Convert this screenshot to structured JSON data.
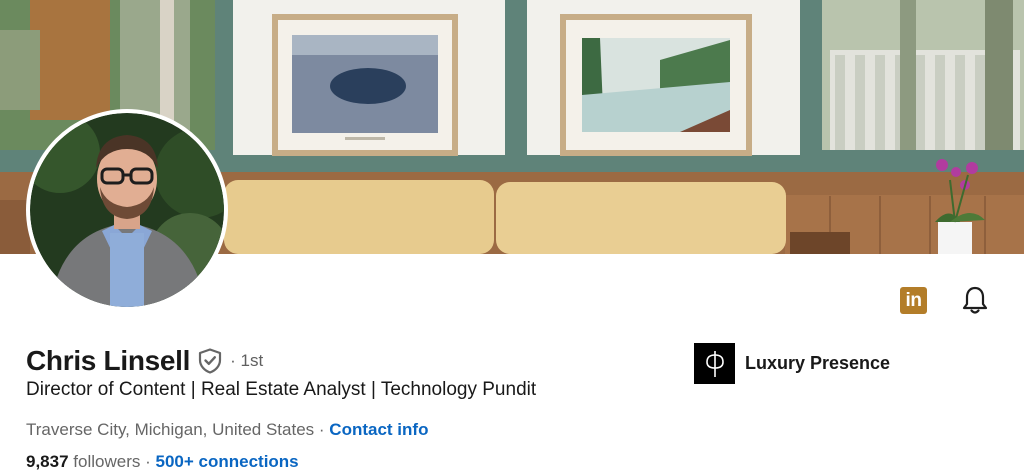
{
  "profile": {
    "name": "Chris Linsell",
    "degree": "· 1st",
    "headline": "Director of Content | Real Estate Analyst | Technology Pundit",
    "location": "Traverse City, Michigan, United States",
    "location_separator": "·",
    "contact_info_label": "Contact info",
    "followers_count": "9,837",
    "followers_label": "followers",
    "stats_separator": "·",
    "connections_label": "500+ connections"
  },
  "company": {
    "name": "Luxury Presence"
  },
  "actions": {
    "linkedin_label": "in"
  },
  "icons": {
    "linkedin": "linkedin-icon",
    "bell": "bell-icon",
    "verified": "verified-shield-icon",
    "company_logo": "luxury-presence-logo"
  },
  "colors": {
    "link": "#0a66c2",
    "text_primary": "#191919",
    "text_secondary": "#666666",
    "linkedin_badge": "#b37d29"
  }
}
